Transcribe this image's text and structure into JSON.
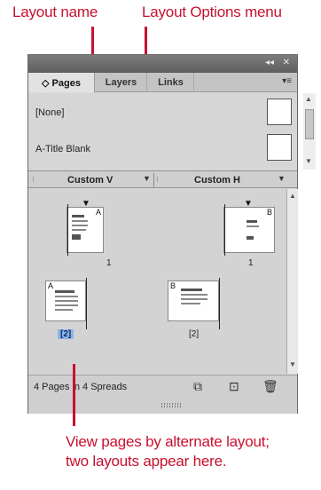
{
  "callouts": {
    "layout_name": "Layout name",
    "layout_options_menu": "Layout Options menu",
    "bottom_line1": "View pages by alternate layout;",
    "bottom_line2": "two layouts appear here."
  },
  "panel": {
    "titlebar": {
      "collapse": "◂◂",
      "close": "✕"
    },
    "tabs": [
      {
        "label": "◇ Pages",
        "active": true
      },
      {
        "label": "Layers",
        "active": false
      },
      {
        "label": "Links",
        "active": false
      }
    ],
    "masters": [
      {
        "label": "[None]"
      },
      {
        "label": "A-Title Blank"
      }
    ],
    "layouts": [
      {
        "label": "Custom V"
      },
      {
        "label": "Custom H"
      }
    ],
    "pages": {
      "layout_v": [
        {
          "label": "1",
          "master": "A"
        },
        {
          "label": "[2]",
          "master": "A",
          "selected": true
        }
      ],
      "layout_h": [
        {
          "label": "1",
          "master": "B"
        },
        {
          "label": "[2]",
          "master": "B"
        }
      ]
    },
    "status": "4 Pages in 4 Spreads"
  },
  "icons": {
    "panel_menu": "panel-menu-icon",
    "edit_page_size": "edit-page-size-icon",
    "new_page": "new-page-icon",
    "delete_page": "trash-icon"
  }
}
